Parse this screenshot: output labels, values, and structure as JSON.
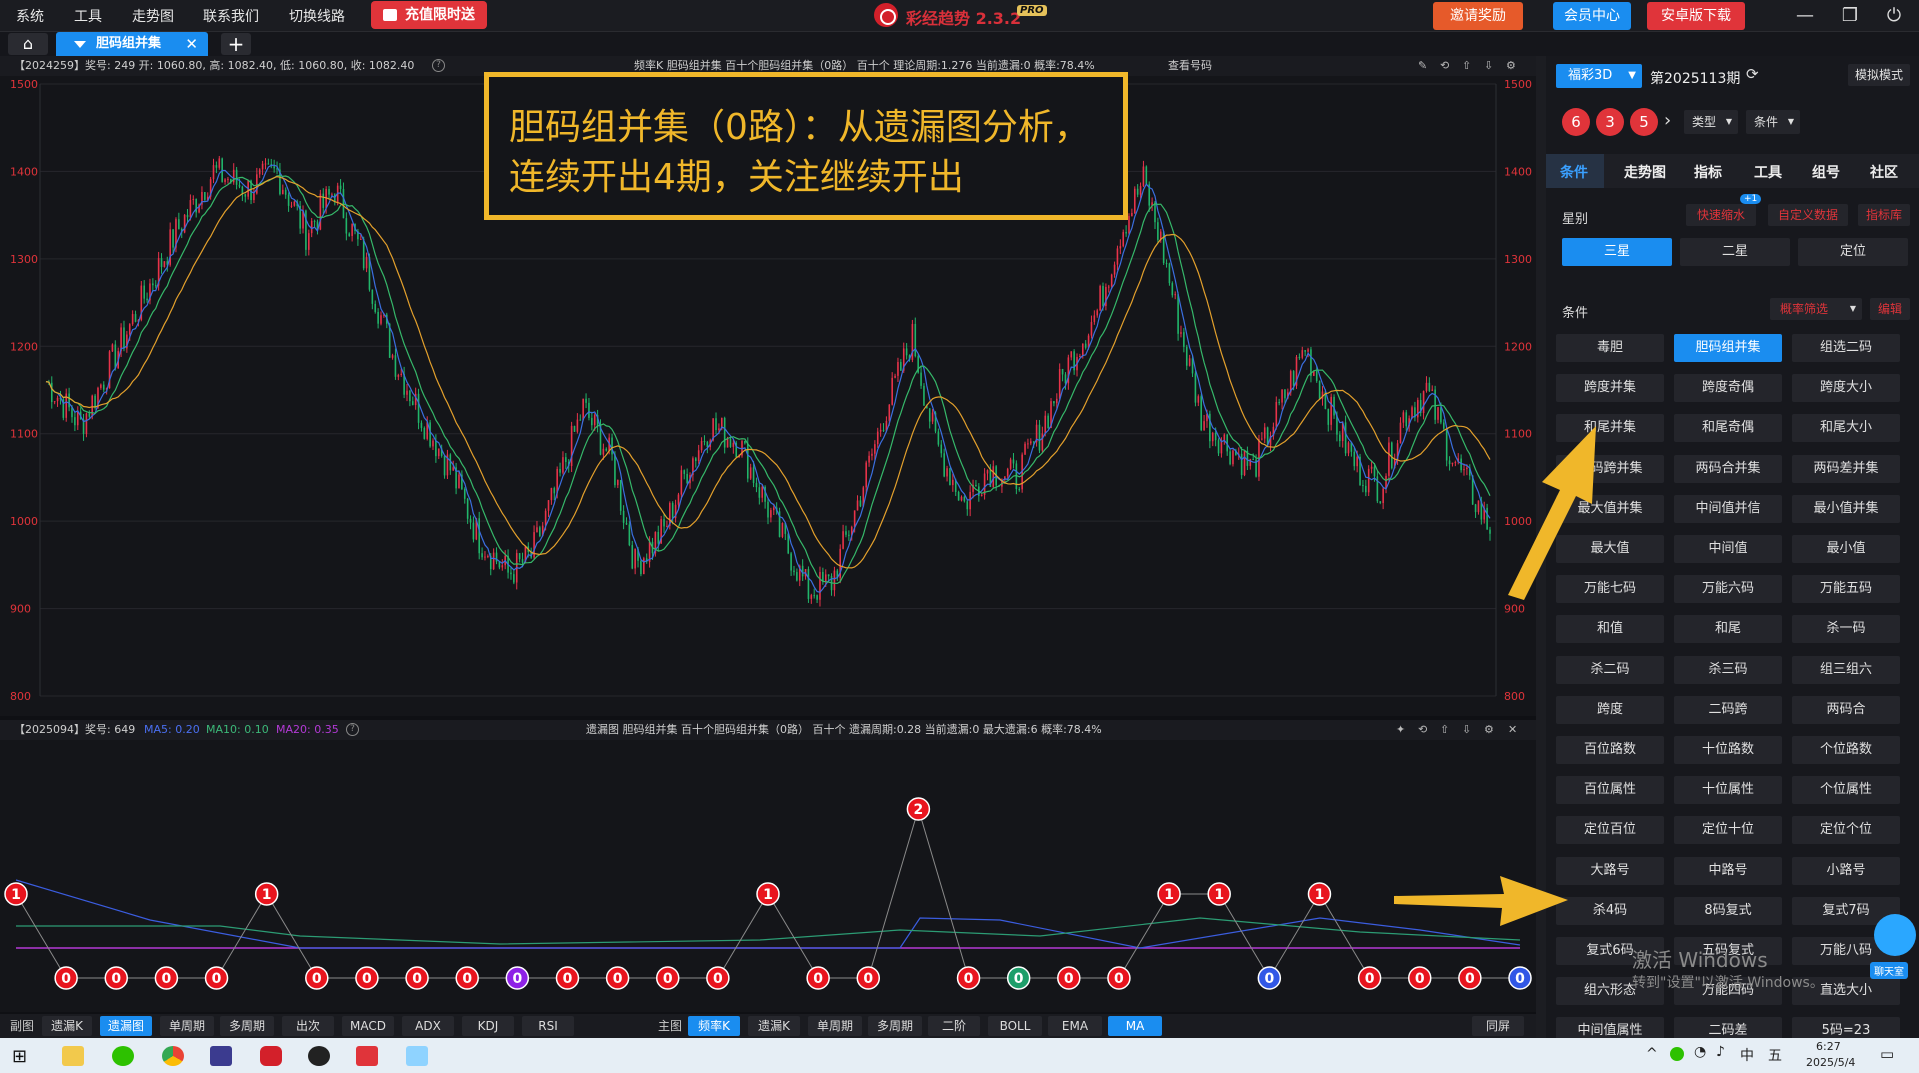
{
  "menu": {
    "items": [
      "系统",
      "工具",
      "走势图",
      "联系我们",
      "切换线路"
    ],
    "promo": "充值限时送"
  },
  "app": {
    "title": "彩经趋势 2.3.2",
    "badge": "PRO"
  },
  "header_buttons": {
    "invite": "邀请奖励",
    "member": "会员中心",
    "android": "安卓版下载"
  },
  "tabs": {
    "active": "胆码组并集"
  },
  "main_chart": {
    "info_left": "【2024259】奖号: 249  开: 1060.80, 高: 1082.40, 低: 1060.80, 收: 1082.40",
    "info_mid": "频率K  胆码组并集  百十个胆码组并集（0路）  百十个  理论周期:1.276  当前遗漏:0  概率:78.4%",
    "query": "查看号码",
    "y_ticks": [
      "1500",
      "1400",
      "1300",
      "1200",
      "1100",
      "1000",
      "900",
      "800"
    ]
  },
  "annotation": {
    "line1": "胆码组并集（0路）：从遗漏图分析，",
    "line2": "连续开出4期，关注继续开出"
  },
  "lower_chart": {
    "info_left_prefix": "【2025094】奖号: 649",
    "ma5": "MA5: 0.20",
    "ma10": "MA10: 0.10",
    "ma20": "MA20: 0.35",
    "info_mid": "遗漏图  胆码组并集  百十个胆码组并集（0路）  百十个  遗漏周期:0.28  当前遗漏:0  最大遗漏:6  概率:78.4%",
    "markers": [
      "1",
      "0",
      "0",
      "0",
      "0",
      "1",
      "0",
      "0",
      "0",
      "0",
      "0",
      "0",
      "0",
      "0",
      "0",
      "1",
      "0",
      "0",
      "2",
      "0",
      "0",
      "0",
      "0",
      "1",
      "1",
      "0",
      "1",
      "0",
      "0",
      "0",
      "0"
    ]
  },
  "bottom_bar": {
    "left_label": "副图",
    "left": [
      "遗漏K",
      "遗漏图",
      "单周期",
      "多周期",
      "出次",
      "MACD",
      "ADX",
      "KDJ",
      "RSI"
    ],
    "right_label": "主图",
    "right": [
      "频率K",
      "遗漏K",
      "单周期",
      "多周期",
      "二阶",
      "BOLL",
      "EMA",
      "MA"
    ],
    "same_screen": "同屏"
  },
  "sidebar": {
    "lottery": "福彩3D",
    "period": "第2025113期",
    "sim": "模拟模式",
    "balls": [
      "6",
      "3",
      "5"
    ],
    "type_label": "类型",
    "cond_label": "条件",
    "tabs": [
      "条件",
      "走势图",
      "指标",
      "工具",
      "组号",
      "社区"
    ],
    "star_label": "星别",
    "badge": "+1",
    "quick": "快速缩水",
    "custom": "自定义数据",
    "lib": "指标库",
    "stars": [
      "三星",
      "二星",
      "定位"
    ],
    "cond_section": "条件",
    "prob_filter": "概率筛选",
    "edit": "编辑",
    "grid": [
      "毒胆",
      "胆码组并集",
      "组选二码",
      "跨度并集",
      "跨度奇偶",
      "跨度大小",
      "和尾并集",
      "和尾奇偶",
      "和尾大小",
      "两码跨并集",
      "两码合并集",
      "两码差并集",
      "最大值并集",
      "中间值并信",
      "最小值并集",
      "最大值",
      "中间值",
      "最小值",
      "万能七码",
      "万能六码",
      "万能五码",
      "和值",
      "和尾",
      "杀一码",
      "杀二码",
      "杀三码",
      "组三组六",
      "跨度",
      "二码跨",
      "两码合",
      "百位路数",
      "十位路数",
      "个位路数",
      "百位属性",
      "十位属性",
      "个位属性",
      "定位百位",
      "定位十位",
      "定位个位",
      "大路号",
      "中路号",
      "小路号",
      "杀4码",
      "8码复式",
      "复式7码",
      "复式6码",
      "五码复式",
      "万能八码",
      "组六形态",
      "万能四码",
      "直选大小",
      "中间值属性",
      "二码差",
      "5码=23"
    ],
    "chat": "聊天室"
  },
  "watermark": {
    "line1": "激活 Windows",
    "line2": "转到\"设置\"以激活 Windows。"
  },
  "taskbar": {
    "time": "6:27",
    "date": "2025/5/4",
    "ime": "中",
    "ime2": "五"
  },
  "colors": {
    "up": "#e8334a",
    "down": "#21b56a",
    "ma_blue": "#3b6fe0",
    "ma_green": "#36b86a",
    "ma_orange": "#e3a02c",
    "accent": "#1a8df0",
    "annot": "#f0b72a"
  }
}
